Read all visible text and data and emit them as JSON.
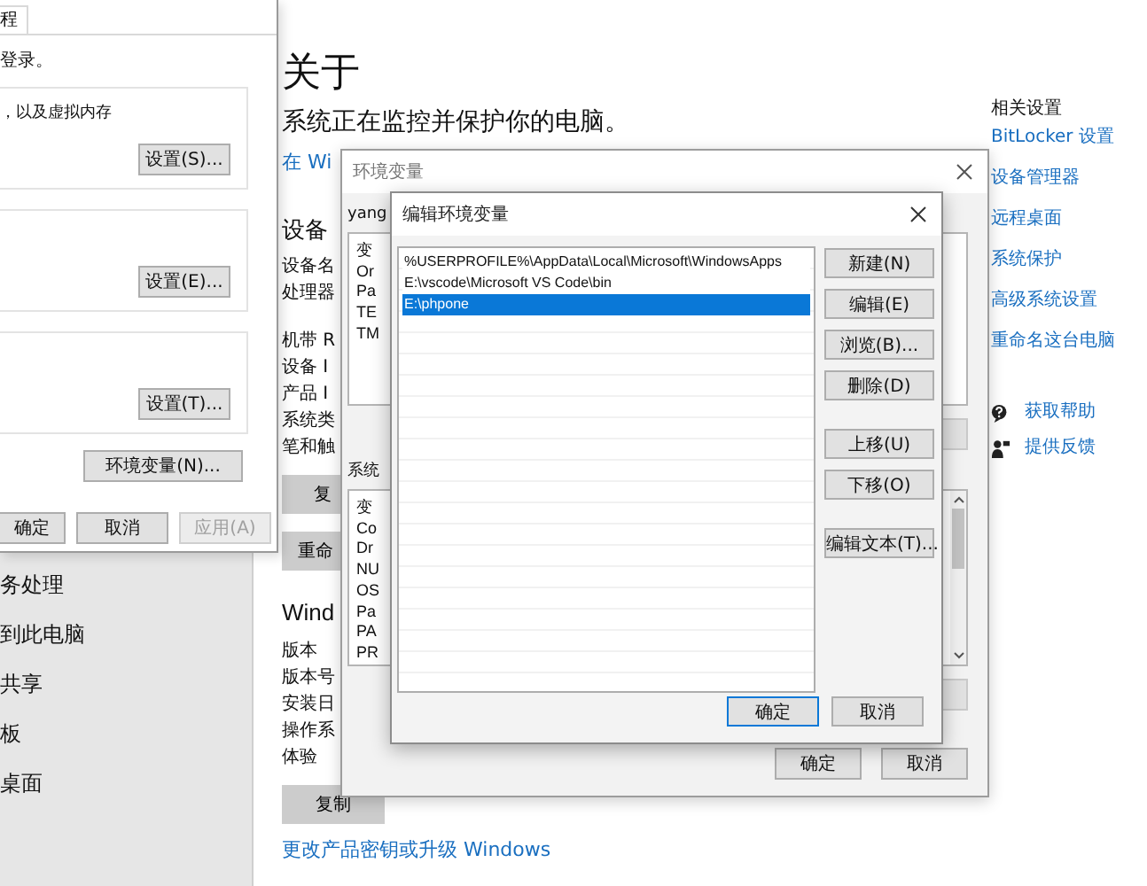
{
  "settings_page": {
    "sidebar_items": [
      "务处理",
      "到此电脑",
      "共享",
      "板",
      "桌面"
    ],
    "heading": "关于",
    "status": "系统正在监控并保护你的电脑。",
    "security_link": "在 Wi",
    "device_heading": "设备",
    "device_spec_groups": [
      [
        "设备名",
        "处理器"
      ],
      [
        "机带 R",
        "设备 I",
        "产品 I",
        "系统类",
        "笔和触"
      ]
    ],
    "device_buttons": [
      "复",
      "重命"
    ],
    "windows_heading": "Wind",
    "windows_specs": [
      "版本",
      "版本号",
      "安装日",
      "操作系",
      "体验"
    ],
    "copy_button": "复制",
    "upgrade_link": "更改产品密钥或升级 Windows",
    "related_heading": "相关设置",
    "related_links": [
      "BitLocker 设置",
      "设备管理器",
      "远程桌面",
      "系统保护",
      "高级系统设置",
      "重命名这台电脑"
    ],
    "support_links": [
      {
        "label": "获取帮助",
        "kind": "help"
      },
      {
        "label": "提供反馈",
        "kind": "feedback"
      }
    ]
  },
  "system_properties": {
    "tab": "程",
    "intro": "登录。",
    "groups": [
      {
        "text": "，以及虚拟内存",
        "button": "设置(S)..."
      },
      {
        "button": "设置(E)..."
      },
      {
        "button": "设置(T)..."
      }
    ],
    "env_button": "环境变量(N)...",
    "footer_buttons": [
      {
        "label": "确定",
        "disabled": false
      },
      {
        "label": "取消",
        "disabled": false
      },
      {
        "label": "应用(A)",
        "disabled": true
      }
    ]
  },
  "env_dialog": {
    "title": "环境变量",
    "user_label": "yang",
    "user_vars": [
      "变",
      "Or",
      "Pa",
      "TE",
      "TM"
    ],
    "system_label": "系统",
    "system_vars": [
      "变",
      "Co",
      "Dr",
      "NU",
      "OS",
      "Pa",
      "PA",
      "PR"
    ],
    "buttons": [
      "确定",
      "取消"
    ]
  },
  "edit_dialog": {
    "title": "编辑环境变量",
    "entries": [
      {
        "text": "%USERPROFILE%\\AppData\\Local\\Microsoft\\WindowsApps",
        "selected": false
      },
      {
        "text": "E:\\vscode\\Microsoft VS Code\\bin",
        "selected": false
      },
      {
        "text": "E:\\phpone",
        "selected": true
      }
    ],
    "side_buttons": [
      [
        "新建(N)",
        "编辑(E)",
        "浏览(B)...",
        "删除(D)"
      ],
      [
        "上移(U)",
        "下移(O)"
      ],
      [
        "编辑文本(T)..."
      ]
    ],
    "ok": "确定",
    "cancel": "取消"
  }
}
